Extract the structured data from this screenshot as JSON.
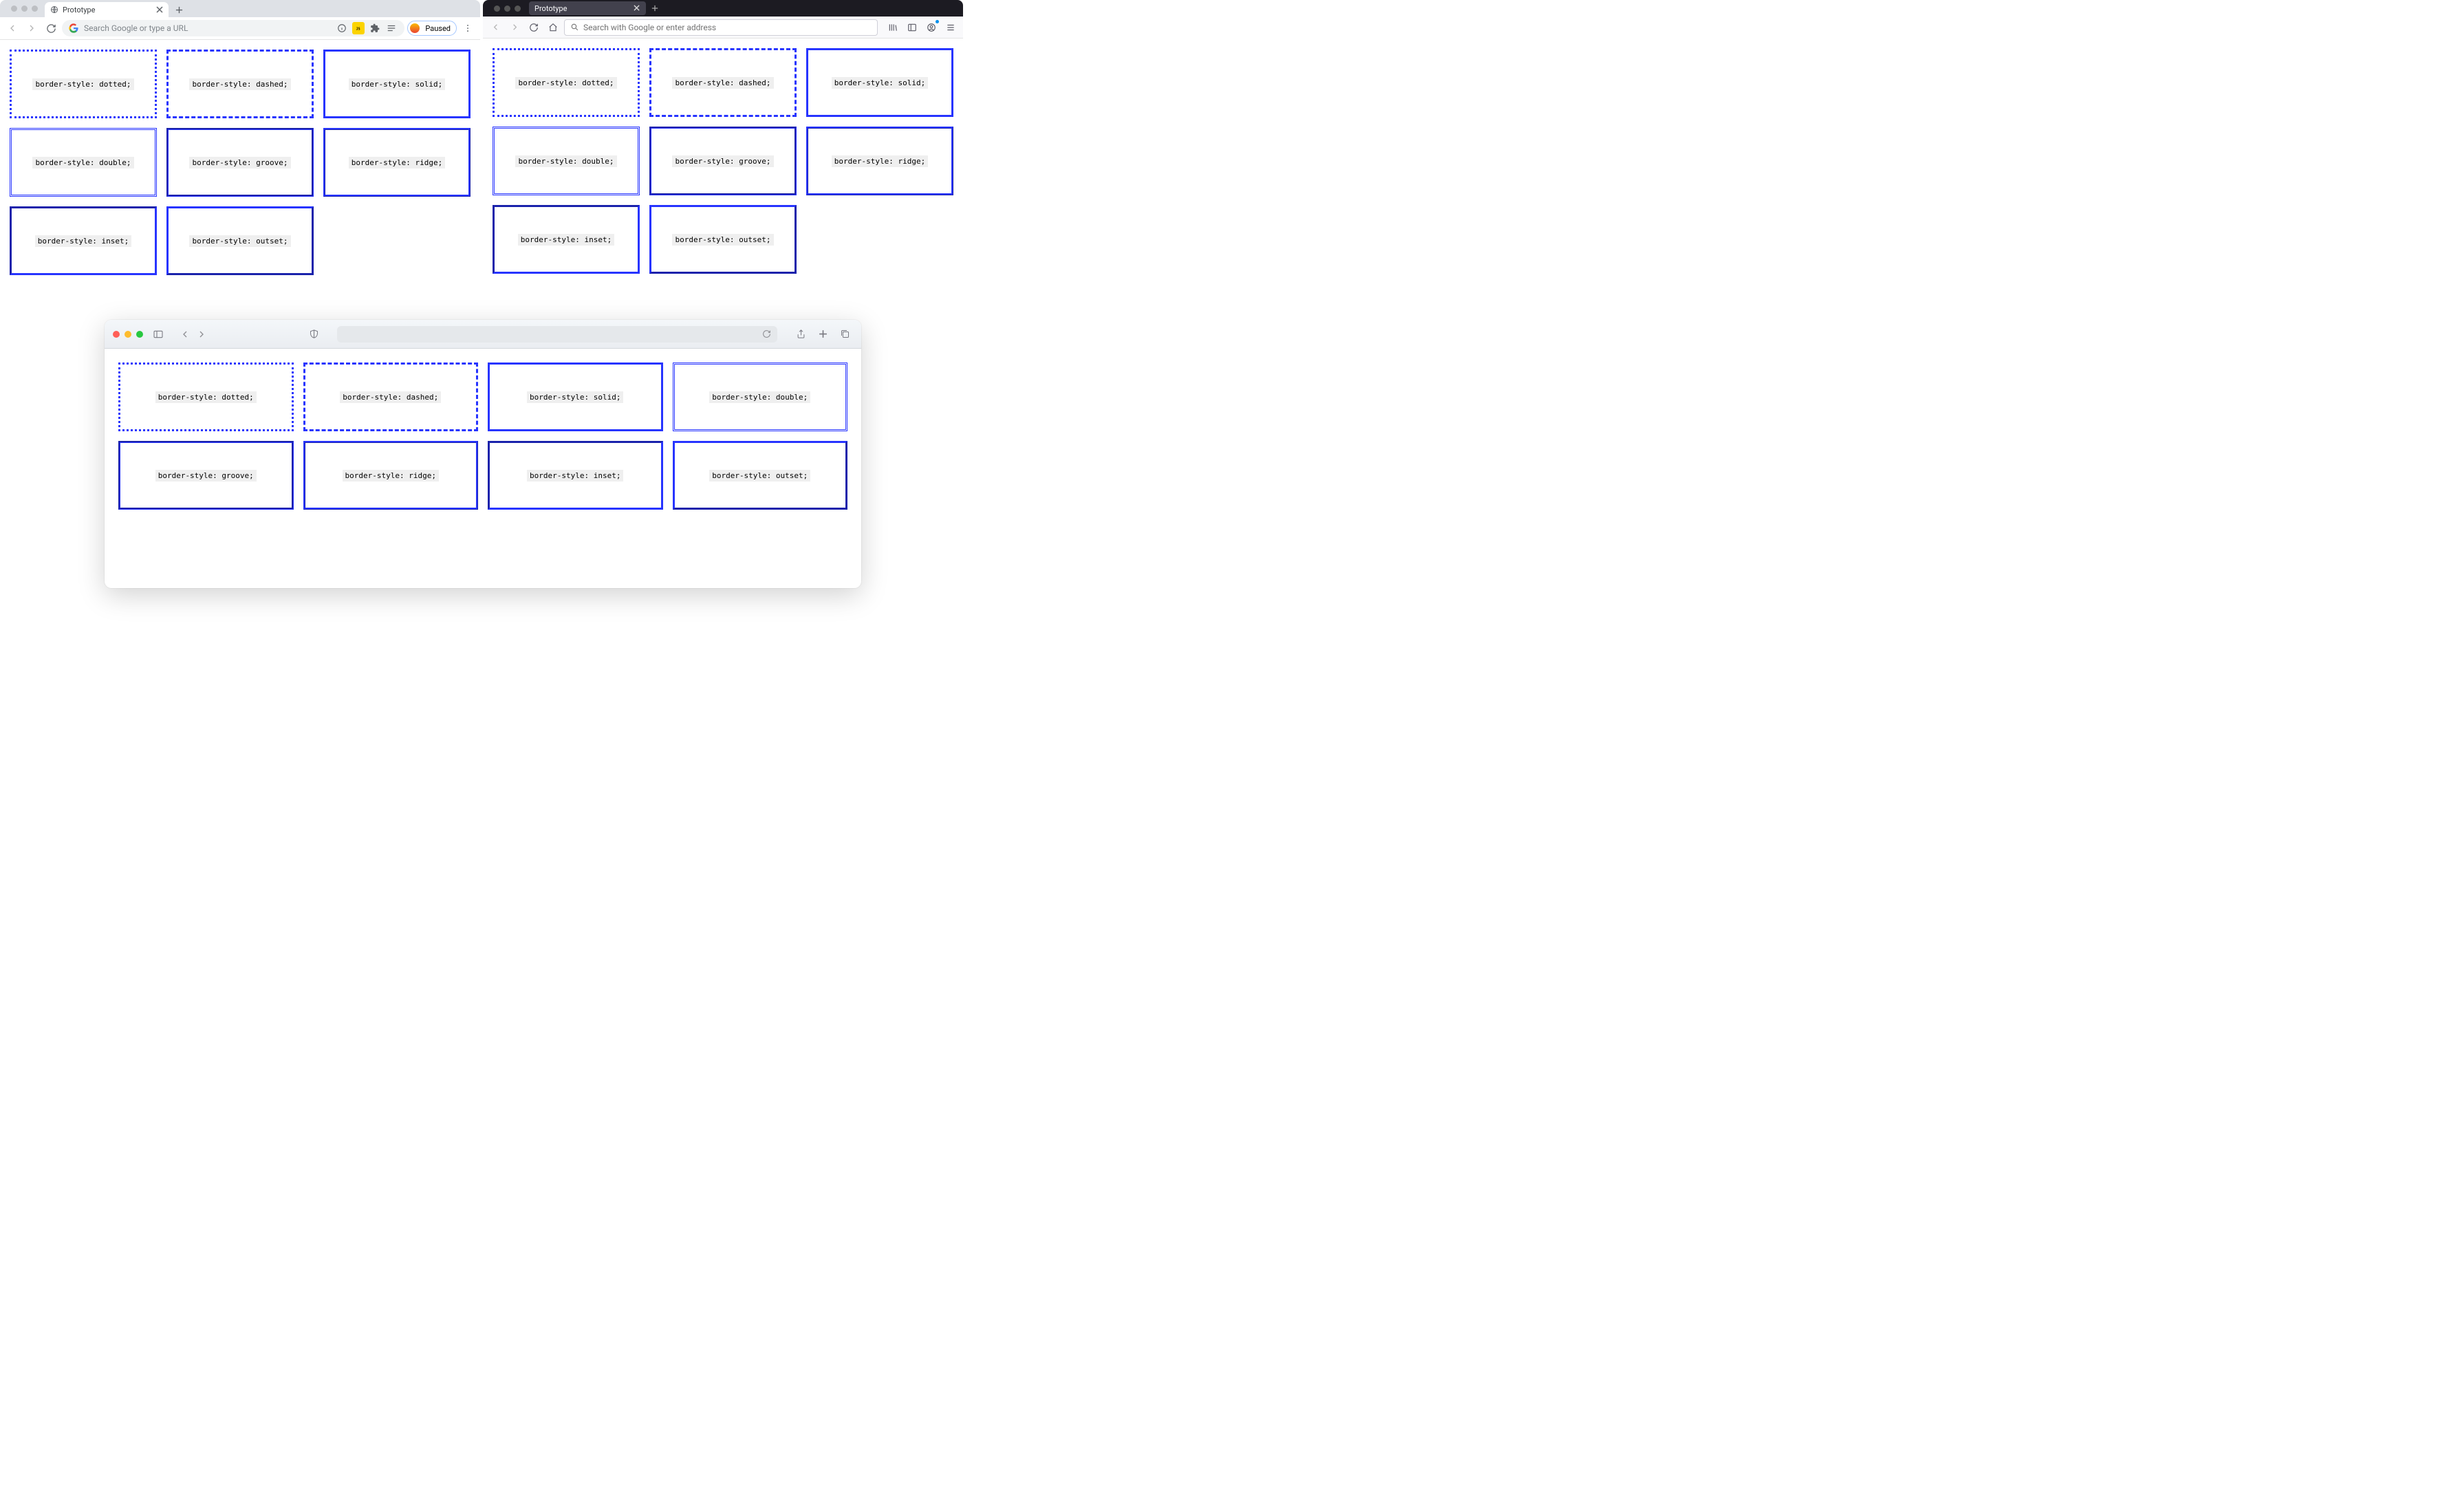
{
  "colors": {
    "border": "#2734ff"
  },
  "chrome": {
    "tab_title": "Prototype",
    "omnibox_placeholder": "Search Google or type a URL",
    "paused_label": "Paused"
  },
  "firefox": {
    "tab_title": "Prototype",
    "urlbar_placeholder": "Search with Google or enter address"
  },
  "safari": {},
  "border_styles": [
    {
      "style": "dotted",
      "label": "border-style: dotted;"
    },
    {
      "style": "dashed",
      "label": "border-style: dashed;"
    },
    {
      "style": "solid",
      "label": "border-style: solid;"
    },
    {
      "style": "double",
      "label": "border-style: double;"
    },
    {
      "style": "groove",
      "label": "border-style: groove;"
    },
    {
      "style": "ridge",
      "label": "border-style: ridge;"
    },
    {
      "style": "inset",
      "label": "border-style: inset;"
    },
    {
      "style": "outset",
      "label": "border-style: outset;"
    }
  ]
}
